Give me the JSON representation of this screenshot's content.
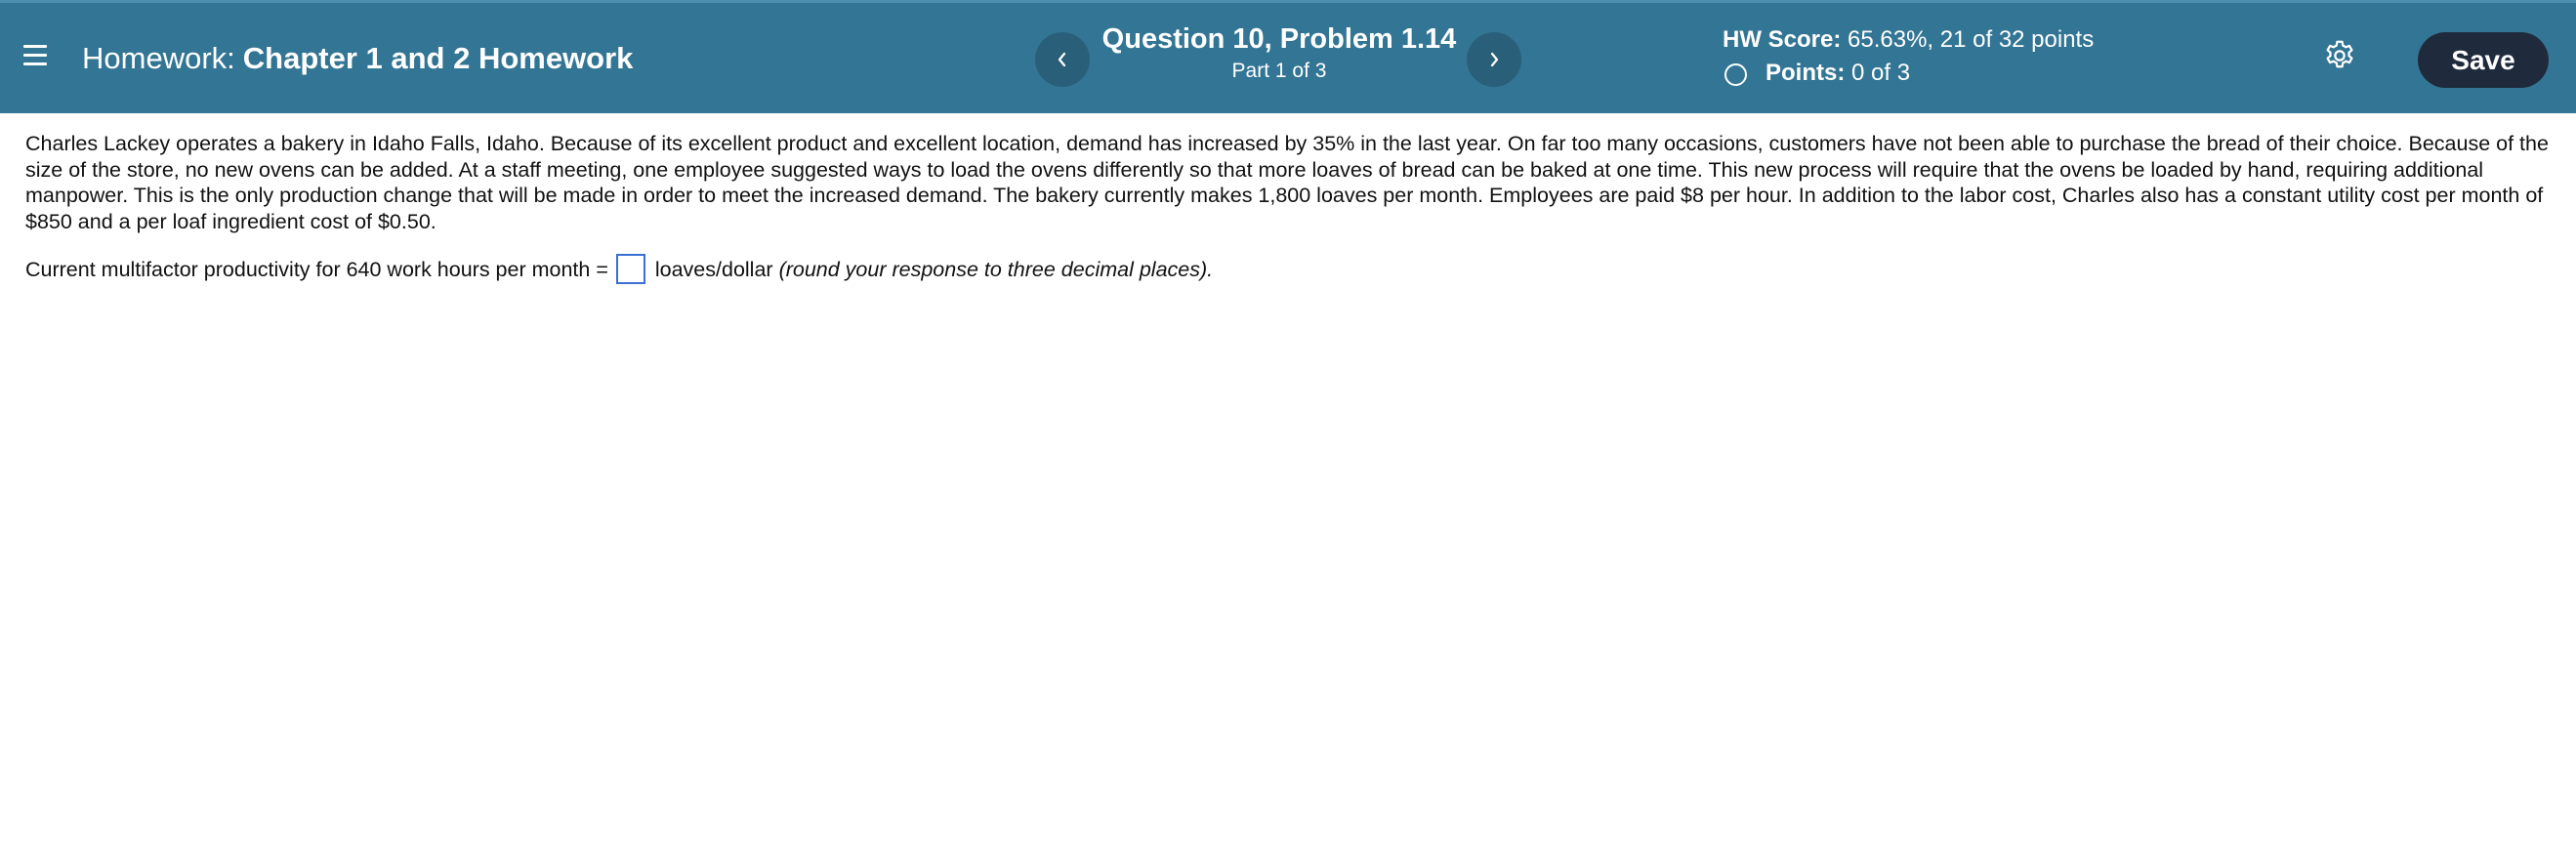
{
  "header": {
    "homework_prefix": "Homework:",
    "homework_name": "Chapter 1 and 2 Homework",
    "question_title": "Question 10, Problem 1.14",
    "question_part": "Part 1 of 3",
    "hw_score_label": "HW Score:",
    "hw_score_value": "65.63%, 21 of 32 points",
    "points_label": "Points:",
    "points_value": "0 of 3",
    "save_label": "Save",
    "icons": {
      "menu": "hamburger-menu-icon",
      "previous": "chevron-left-icon",
      "next": "chevron-right-icon",
      "points": "circle-outline-icon",
      "settings": "gear-icon"
    }
  },
  "problem": {
    "text": "Charles Lackey operates a bakery in Idaho Falls, Idaho.  Because of its excellent product and excellent location, demand has increased by 35% in the last year. On far too many occasions, customers have not been able to purchase the bread of their choice. Because of the size of the store, no new ovens can be added. At a staff meeting, one employee suggested ways to load the ovens differently so that more loaves of bread can be baked at one time. This new process will require that the ovens be loaded by hand, requiring additional manpower. This is the only production change that will be made in order to meet the increased demand. The bakery currently makes 1,800 loaves per month.  Employees are paid $8 per hour. In addition to the labor cost, Charles also has a constant utility cost per month of $850 and a per loaf ingredient cost of $0.50.",
    "answer_prefix": "Current multifactor productivity for 640 work hours per month =",
    "answer_value": "",
    "answer_unit": "loaves/dollar",
    "answer_hint": "(round your response to three decimal places)."
  },
  "colors": {
    "header_bg": "#337594",
    "nav_button_bg": "#2a5f79",
    "save_button_bg": "#1f2b3c",
    "input_border": "#3b6fd1"
  }
}
